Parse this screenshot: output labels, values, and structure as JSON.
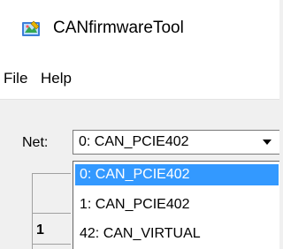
{
  "window": {
    "title": "CANfirmwareTool",
    "icon": "app-tool-icon"
  },
  "menubar": {
    "items": [
      {
        "label": "File"
      },
      {
        "label": "Help"
      }
    ]
  },
  "net": {
    "label": "Net:",
    "selected": "0: CAN_PCIE402",
    "options": [
      {
        "label": "0: CAN_PCIE402",
        "highlighted": true
      },
      {
        "label": "1: CAN_PCIE402",
        "highlighted": false
      },
      {
        "label": "42: CAN_VIRTUAL",
        "highlighted": false
      }
    ]
  },
  "grid": {
    "header": "",
    "rows": [
      {
        "label": "1"
      }
    ]
  },
  "colors": {
    "highlight": "#3399ff",
    "highlight_text": "#ffffff",
    "window_bg": "#f0f0f0"
  }
}
